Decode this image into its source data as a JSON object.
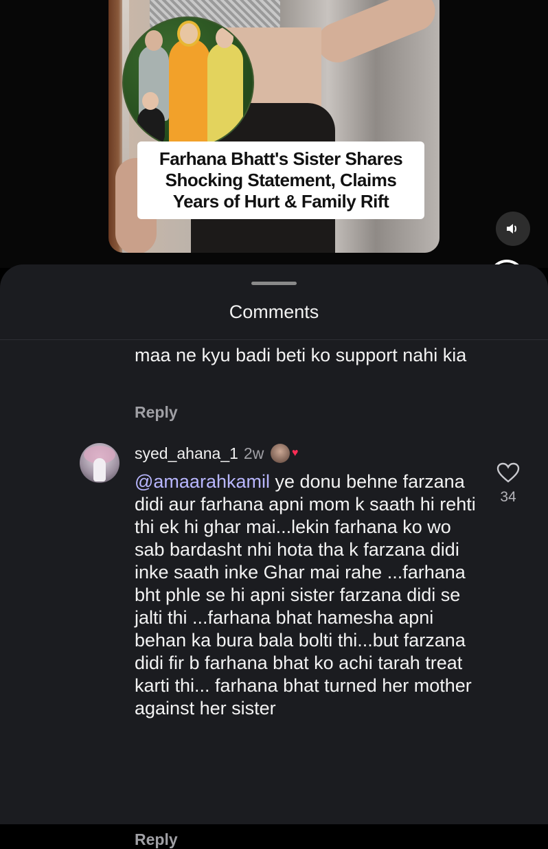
{
  "post": {
    "caption": "Farhana Bhatt's Sister Shares Shocking Statement, Claims Years of Hurt & Family Rift"
  },
  "comments_sheet": {
    "title": "Comments",
    "previous_comment": {
      "text": "maa ne kyu badi beti ko support nahi kia",
      "reply_label": "Reply"
    },
    "comment": {
      "username": "syed_ahana_1",
      "time": "2w",
      "mention": "@amaarahkamil",
      "text": " ye donu behne farzana didi aur farhana apni mom k saath hi rehti thi ek hi ghar mai...lekin farhana ko wo sab bardasht nhi hota tha k farzana didi inke saath inke Ghar mai rahe ...farhana bht phle se hi apni sister farzana didi se jalti thi ...farhana bhat hamesha apni behan ka bura bala bolti thi...but farzana didi fir b  farhana bhat ko achi tarah treat karti thi... farhana bhat turned her mother against her sister",
      "likes": "34",
      "reply_label": "Reply"
    }
  },
  "icons": {
    "sound": "speaker-icon",
    "like": "heart-outline-icon",
    "liked_by_creator": "heart-filled-icon"
  },
  "colors": {
    "sheet_background": "#1b1c20",
    "mention": "#b9b7ff",
    "secondary_text": "#a0a0a5",
    "heart_badge": "#ff2d55"
  }
}
